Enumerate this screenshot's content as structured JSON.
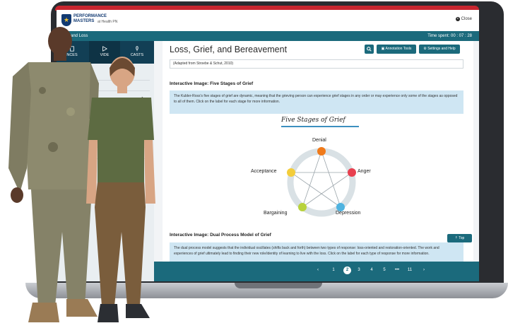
{
  "brand": {
    "logo_line1": "PERFORMANCE",
    "logo_line2": "MASTERS",
    "product": "at Health PN"
  },
  "window": {
    "close_label": "Close"
  },
  "titlebar": {
    "crumb": "ief and Loss",
    "time": "Time spent: 00 : 07 : 28"
  },
  "sidebar": {
    "tabs": [
      {
        "label": "NCES"
      },
      {
        "label": "VIDE"
      },
      {
        "label": "CASTS"
      }
    ]
  },
  "page": {
    "title": "Loss, Grief, and Bereavement",
    "buttons": {
      "annotation": "Annotation Tools",
      "settings": "Settings and Help"
    },
    "adapted": "(Adapted from Stroebe & Schut, 2010)",
    "section1": {
      "heading": "Interactive Image: Five Stages of Grief",
      "text": "The Kubler-Ross's five stages of grief are dynamic, meaning that the grieving person can experience grief stages in any order or may experience only some of the stages as opposed to all of them. Click on the label for each stage for more information."
    },
    "figure": {
      "title": "Five Stages of Grief",
      "stages": [
        {
          "label": "Denial",
          "color": "#f07a1a"
        },
        {
          "label": "Anger",
          "color": "#e8404f"
        },
        {
          "label": "Depression",
          "color": "#4fb3e0"
        },
        {
          "label": "Bargaining",
          "color": "#b8d23c"
        },
        {
          "label": "Acceptance",
          "color": "#f3cd3b"
        }
      ]
    },
    "section2": {
      "heading": "Interactive Image: Dual Process Model of Grief",
      "text": "The dual process model suggests that the individual oscillates (shifts back and forth) between two types of response: loss-oriented and restoration-oriented. The work and experiences of grief ultimately lead to finding their new role/identity of learning to live with the loss. Click on the label for each type of response for more information."
    },
    "top_button": "Top"
  },
  "pager": {
    "prev": "‹",
    "pages": [
      "1",
      "2",
      "3",
      "4",
      "5",
      "•••",
      "11"
    ],
    "active": "2",
    "next": "›"
  },
  "colors": {
    "teal": "#1b6a7c",
    "navy": "#123f55",
    "red": "#c8262f",
    "info": "#cfe6f3"
  }
}
